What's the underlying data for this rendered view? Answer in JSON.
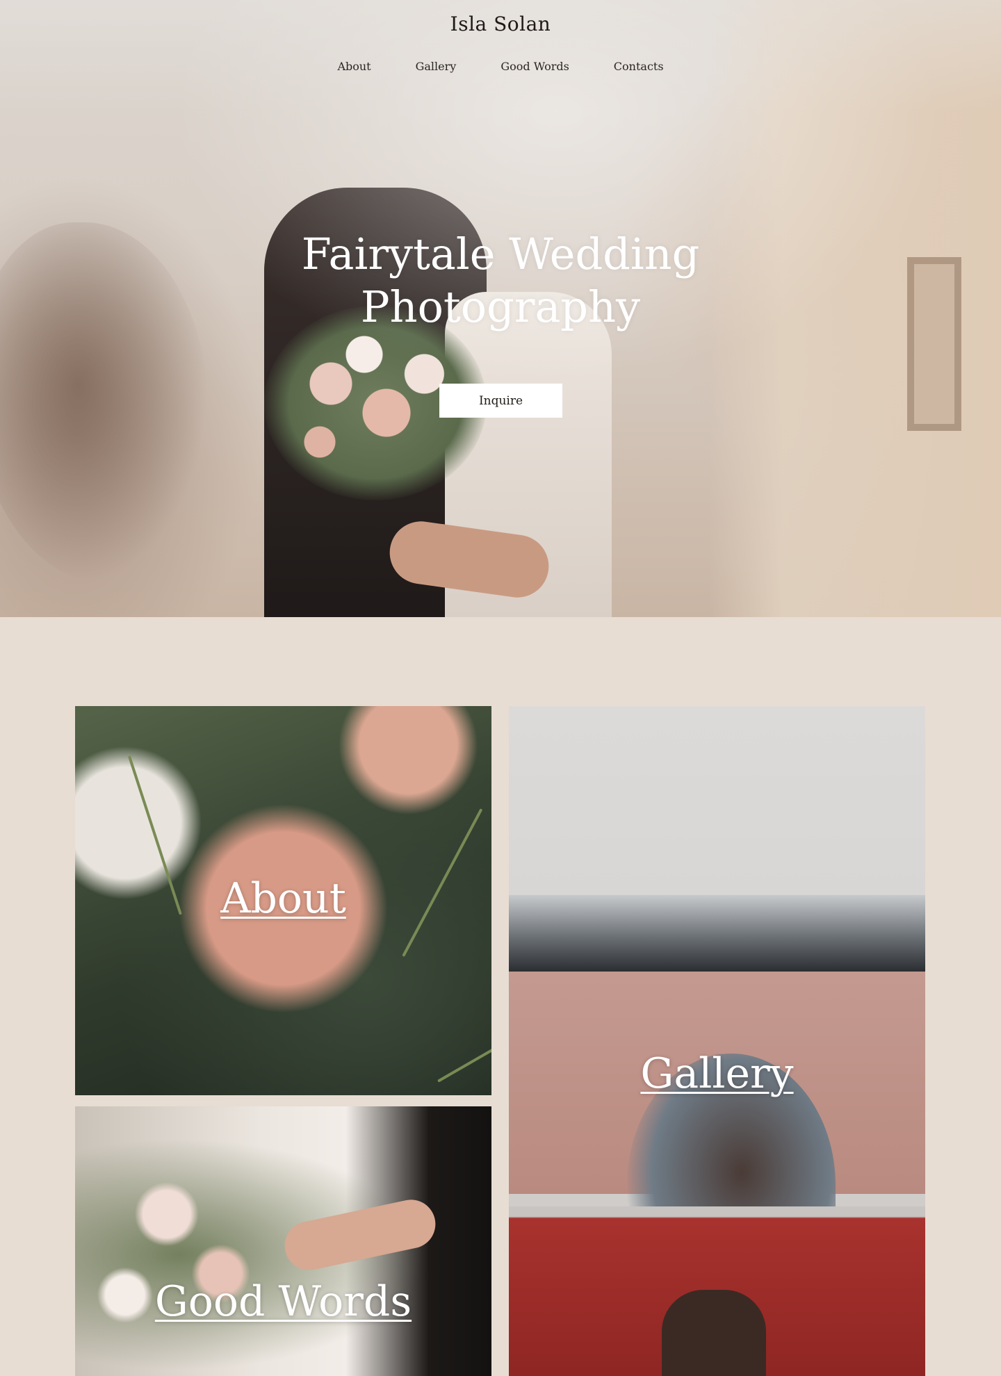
{
  "header": {
    "site_title": "Isla Solan",
    "nav": [
      "About",
      "Gallery",
      "Good Words",
      "Contacts"
    ]
  },
  "hero": {
    "heading_line1": "Fairytale Wedding",
    "heading_line2": "Photography",
    "cta_label": "Inquire"
  },
  "tiles": {
    "about": "About",
    "gallery": "Gallery",
    "good_words": "Good Words"
  },
  "colors": {
    "page_background": "#e7ddd3",
    "text_dark": "#1f1a17",
    "text_light": "#ffffff",
    "button_background": "#ffffff"
  }
}
